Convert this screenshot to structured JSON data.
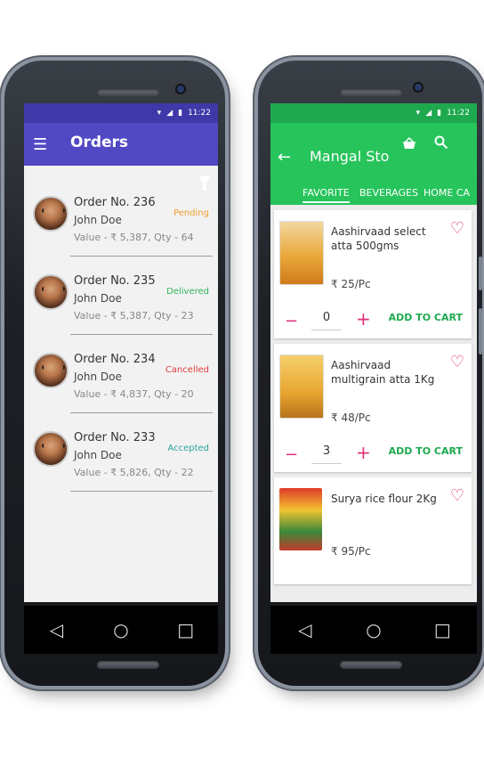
{
  "left_phone": {
    "status_time": "11:22",
    "app_title": "Orders",
    "orders": [
      {
        "number": "Order No. 236",
        "customer": "John Doe",
        "details": "Value - ₹ 5,387, Qty - 64",
        "status": "Pending",
        "status_color": "#f0a030"
      },
      {
        "number": "Order No. 235",
        "customer": "John Doe",
        "details": "Value - ₹ 5,387, Qty - 23",
        "status": "Delivered",
        "status_color": "#2fb45a"
      },
      {
        "number": "Order No. 234",
        "customer": "John Doe",
        "details": "Value - ₹ 4,837, Qty - 20",
        "status": "Cancelled",
        "status_color": "#e23b3b"
      },
      {
        "number": "Order No. 233",
        "customer": "John Doe",
        "details": "Value - ₹ 5,826, Qty - 22",
        "status": "Accepted",
        "status_color": "#2aa5a0"
      }
    ]
  },
  "right_phone": {
    "status_time": "11:22",
    "store_title": "Mangal Sto",
    "tabs": [
      "FAVORITE",
      "BEVERAGES",
      "HOME CA"
    ],
    "active_tab": "FAVORITE",
    "products": [
      {
        "name": "Aashirvaad select atta 500gms",
        "price": "₹ 25/Pc",
        "qty": "0",
        "cart_label": "ADD TO CART"
      },
      {
        "name": "Aashirvaad multigrain atta 1Kg",
        "price": "₹ 48/Pc",
        "qty": "3",
        "cart_label": "ADD TO CART"
      },
      {
        "name": "Surya rice flour 2Kg",
        "price": "₹ 95/Pc",
        "qty": "",
        "cart_label": ""
      }
    ]
  },
  "colors": {
    "left_appbar": "#5149c4",
    "right_appbar": "#26c45b",
    "accent_pink": "#e0307a",
    "accent_green": "#1ea94f"
  },
  "icons": {
    "menu": "☰",
    "back": "←",
    "heart": "♡",
    "search": "⌕",
    "nav_back": "◁",
    "nav_home": "○",
    "nav_recent": "□"
  }
}
